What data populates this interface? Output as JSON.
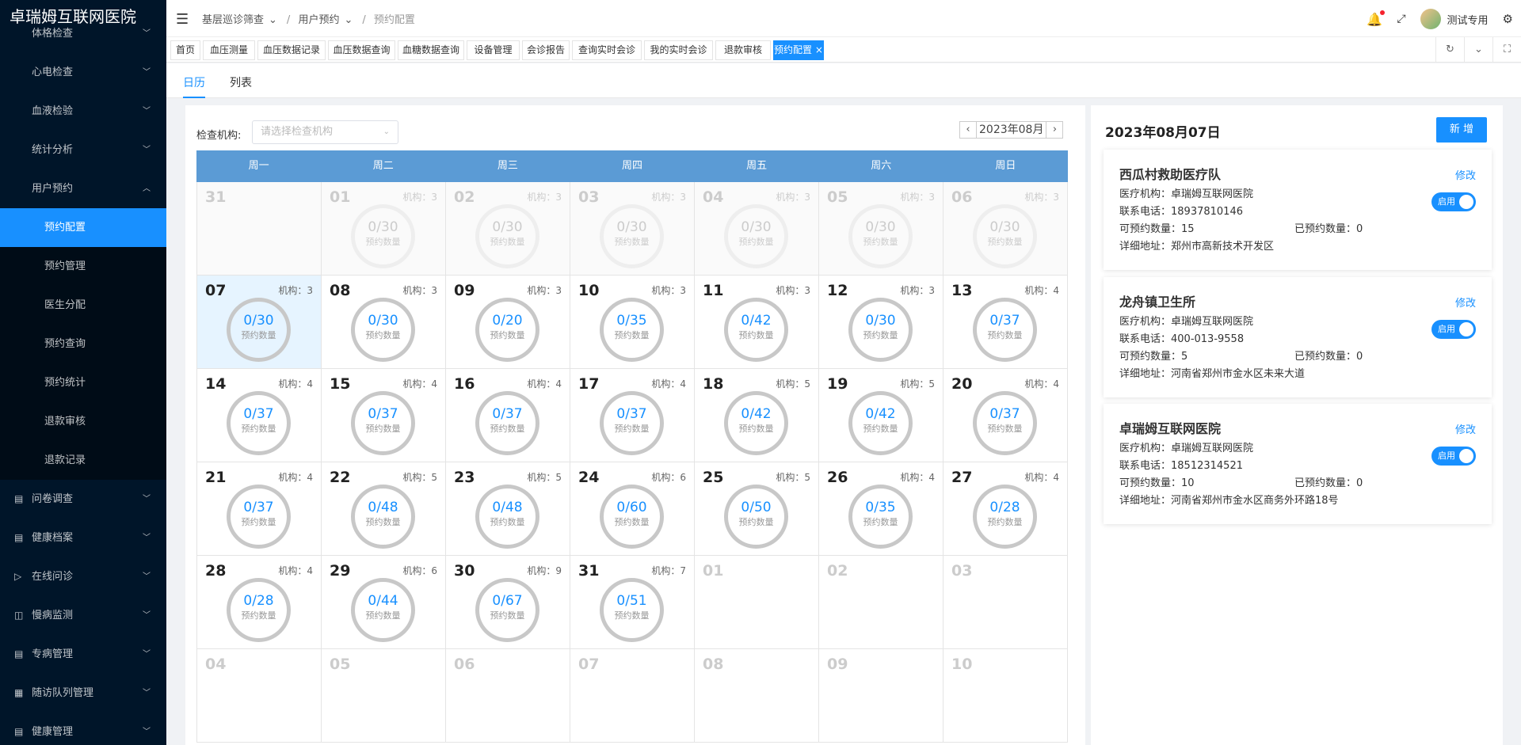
{
  "brand": "卓瑞姆互联网医院",
  "sidebar": {
    "top_items": [
      {
        "label": "体格检查"
      },
      {
        "label": "心电检查"
      },
      {
        "label": "血液检验"
      },
      {
        "label": "统计分析"
      },
      {
        "label": "用户预约"
      }
    ],
    "sub_items": [
      {
        "label": "预约配置"
      },
      {
        "label": "预约管理"
      },
      {
        "label": "医生分配"
      },
      {
        "label": "预约查询"
      },
      {
        "label": "预约统计"
      },
      {
        "label": "退款审核"
      },
      {
        "label": "退款记录"
      }
    ],
    "bottom_items": [
      {
        "label": "问卷调查"
      },
      {
        "label": "健康档案"
      },
      {
        "label": "在线问诊"
      },
      {
        "label": "慢病监测"
      },
      {
        "label": "专病管理"
      },
      {
        "label": "随访队列管理"
      },
      {
        "label": "健康管理"
      }
    ]
  },
  "breadcrumb": [
    "基层巡诊筛查",
    "用户预约",
    "预约配置"
  ],
  "user": {
    "name": "测试专用"
  },
  "tabs": [
    "首页",
    "血压测量",
    "血压数据记录",
    "血压数据查询",
    "血糖数据查询",
    "设备管理",
    "会诊报告",
    "查询实时会诊",
    "我的实时会诊",
    "退款审核",
    "预约配置"
  ],
  "view_tabs": [
    "日历",
    "列表"
  ],
  "filter": {
    "label": "检查机构:",
    "placeholder": "请选择检查机构"
  },
  "month": "2023年08月",
  "weekdays": [
    "周一",
    "周二",
    "周三",
    "周四",
    "周五",
    "周六",
    "周日"
  ],
  "org_prefix": "机构：",
  "ring_label": "预约数量",
  "calendar": [
    [
      {
        "d": "31",
        "other": true
      },
      {
        "d": "01",
        "org": "3",
        "v": "0/30",
        "other": true
      },
      {
        "d": "02",
        "org": "3",
        "v": "0/30",
        "other": true
      },
      {
        "d": "03",
        "org": "3",
        "v": "0/30",
        "other": true
      },
      {
        "d": "04",
        "org": "3",
        "v": "0/30",
        "other": true
      },
      {
        "d": "05",
        "org": "3",
        "v": "0/30",
        "other": true
      },
      {
        "d": "06",
        "org": "3",
        "v": "0/30",
        "other": true
      }
    ],
    [
      {
        "d": "07",
        "org": "3",
        "v": "0/30",
        "selected": true
      },
      {
        "d": "08",
        "org": "3",
        "v": "0/30"
      },
      {
        "d": "09",
        "org": "3",
        "v": "0/20"
      },
      {
        "d": "10",
        "org": "3",
        "v": "0/35"
      },
      {
        "d": "11",
        "org": "3",
        "v": "0/42"
      },
      {
        "d": "12",
        "org": "3",
        "v": "0/30"
      },
      {
        "d": "13",
        "org": "4",
        "v": "0/37"
      }
    ],
    [
      {
        "d": "14",
        "org": "4",
        "v": "0/37"
      },
      {
        "d": "15",
        "org": "4",
        "v": "0/37"
      },
      {
        "d": "16",
        "org": "4",
        "v": "0/37"
      },
      {
        "d": "17",
        "org": "4",
        "v": "0/37"
      },
      {
        "d": "18",
        "org": "5",
        "v": "0/42"
      },
      {
        "d": "19",
        "org": "5",
        "v": "0/42"
      },
      {
        "d": "20",
        "org": "4",
        "v": "0/37"
      }
    ],
    [
      {
        "d": "21",
        "org": "4",
        "v": "0/37"
      },
      {
        "d": "22",
        "org": "5",
        "v": "0/48"
      },
      {
        "d": "23",
        "org": "5",
        "v": "0/48"
      },
      {
        "d": "24",
        "org": "6",
        "v": "0/60"
      },
      {
        "d": "25",
        "org": "5",
        "v": "0/50"
      },
      {
        "d": "26",
        "org": "4",
        "v": "0/35"
      },
      {
        "d": "27",
        "org": "4",
        "v": "0/28"
      }
    ],
    [
      {
        "d": "28",
        "org": "4",
        "v": "0/28"
      },
      {
        "d": "29",
        "org": "6",
        "v": "0/44"
      },
      {
        "d": "30",
        "org": "9",
        "v": "0/67"
      },
      {
        "d": "31",
        "org": "7",
        "v": "0/51"
      },
      {
        "d": "01",
        "blank": true
      },
      {
        "d": "02",
        "blank": true
      },
      {
        "d": "03",
        "blank": true
      }
    ],
    [
      {
        "d": "04",
        "blank": true
      },
      {
        "d": "05",
        "blank": true
      },
      {
        "d": "06",
        "blank": true
      },
      {
        "d": "07",
        "blank": true
      },
      {
        "d": "08",
        "blank": true
      },
      {
        "d": "09",
        "blank": true
      },
      {
        "d": "10",
        "blank": true
      }
    ]
  ],
  "side": {
    "date": "2023年08月07日",
    "add_label": "新 增",
    "edit_label": "修改",
    "toggle_label": "启用",
    "cards": [
      {
        "name": "西瓜村救助医疗队",
        "org": "医疗机构：卓瑞姆互联网医院",
        "phone": "联系电话：18937810146",
        "avail": "可预约数量：15",
        "booked": "已预约数量：0",
        "addr": "详细地址：郑州市高新技术开发区"
      },
      {
        "name": "龙舟镇卫生所",
        "org": "医疗机构：卓瑞姆互联网医院",
        "phone": "联系电话：400-013-9558",
        "avail": "可预约数量：5",
        "booked": "已预约数量：0",
        "addr": "详细地址：河南省郑州市金水区未来大道"
      },
      {
        "name": "卓瑞姆互联网医院",
        "org": "医疗机构：卓瑞姆互联网医院",
        "phone": "联系电话：18512314521",
        "avail": "可预约数量：10",
        "booked": "已预约数量：0",
        "addr": "详细地址：河南省郑州市金水区商务外环路18号"
      }
    ]
  }
}
